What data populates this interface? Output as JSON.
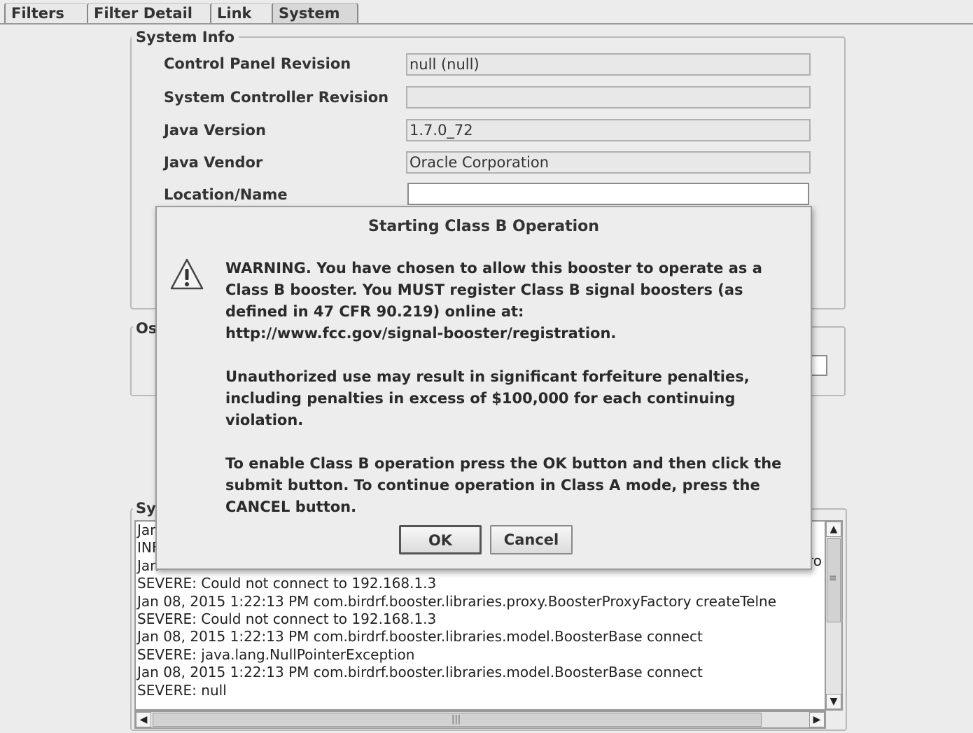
{
  "tabs": [
    {
      "label": "Filters"
    },
    {
      "label": "Filter Detail"
    },
    {
      "label": "Link"
    },
    {
      "label": "System"
    }
  ],
  "system_info": {
    "title": "System Info",
    "rows": [
      {
        "label": "Control Panel Revision",
        "value": "null (null)"
      },
      {
        "label": "System Controller  Revision",
        "value": ""
      },
      {
        "label": "Java Version",
        "value": "1.7.0_72"
      },
      {
        "label": "Java Vendor",
        "value": "Oracle Corporation"
      },
      {
        "label": "Location/Name",
        "value": ""
      }
    ]
  },
  "partial_group_title": "Os",
  "log_group_title": "Sy",
  "log": {
    "lines": [
      "Jan",
      "INF",
      "Jan",
      "SEVERE: Could not connect to 192.168.1.3",
      "Jan 08, 2015 1:22:13 PM com.birdrf.booster.libraries.proxy.BoosterProxyFactory createTelne",
      "SEVERE: Could not connect to 192.168.1.3",
      "Jan 08, 2015 1:22:13 PM com.birdrf.booster.libraries.model.BoosterBase connect",
      "SEVERE: java.lang.NullPointerException",
      "Jan 08, 2015 1:22:13 PM com.birdrf.booster.libraries.model.BoosterBase connect",
      "SEVERE: null"
    ],
    "cut_text": "ro"
  },
  "dialog": {
    "title": "Starting Class B Operation",
    "icon": "warning-icon",
    "paragraphs": [
      "WARNING.  You have chosen to allow this booster to operate as a\nClass B booster.  You MUST register Class B signal boosters (as\ndefined in 47 CFR 90.219) online at:\nhttp://www.fcc.gov/signal-booster/registration.",
      "Unauthorized use may result in significant forfeiture penalties,\nincluding penalties in excess of $100,000 for each continuing\nviolation.",
      "To enable Class B operation press the OK button and then click the\nsubmit button.  To continue operation in Class A mode, press  the\nCANCEL button."
    ],
    "ok_label": "OK",
    "cancel_label": "Cancel"
  },
  "scrollbar_glyphs": {
    "up": "▲",
    "down": "▼",
    "left": "◀",
    "right": "▶",
    "grip_v": "≡",
    "grip_h": "|||"
  }
}
